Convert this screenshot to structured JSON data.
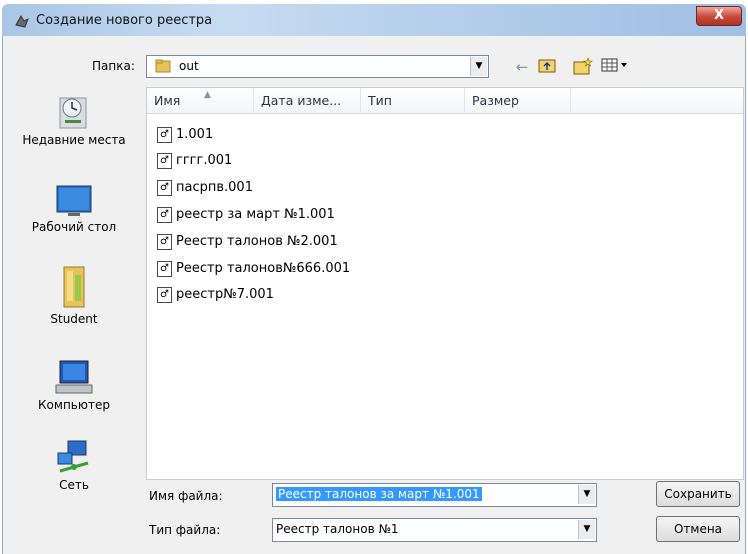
{
  "window": {
    "title": "Создание нового реестра",
    "close_glyph": "X"
  },
  "folder": {
    "label": "Папка:",
    "value": "out"
  },
  "toolbar": {
    "back_icon": "back-arrow-icon",
    "up_icon": "up-folder-icon",
    "new_folder_icon": "new-folder-icon",
    "views_icon": "views-menu-icon"
  },
  "places": [
    {
      "label": "Недавние места",
      "icon": "recent-places-icon"
    },
    {
      "label": "Рабочий стол",
      "icon": "desktop-icon"
    },
    {
      "label": "Student",
      "icon": "user-folder-icon"
    },
    {
      "label": "Компьютер",
      "icon": "computer-icon"
    },
    {
      "label": "Сеть",
      "icon": "network-icon"
    }
  ],
  "columns": [
    "Имя",
    "Дата изме...",
    "Тип",
    "Размер"
  ],
  "files": [
    "1.001",
    "гггг.001",
    "пасрпв.001",
    "реестр за март №1.001",
    "Реестр талонов №2.001",
    "Реестр талонов№666.001",
    "реестр№7.001"
  ],
  "filename": {
    "label": "Имя файла:",
    "value": "Реестр талонов  за март №1.001"
  },
  "filetype": {
    "label": "Тип файла:",
    "value": "Реестр талонов №1"
  },
  "buttons": {
    "save": "Сохранить",
    "cancel": "Отмена"
  }
}
